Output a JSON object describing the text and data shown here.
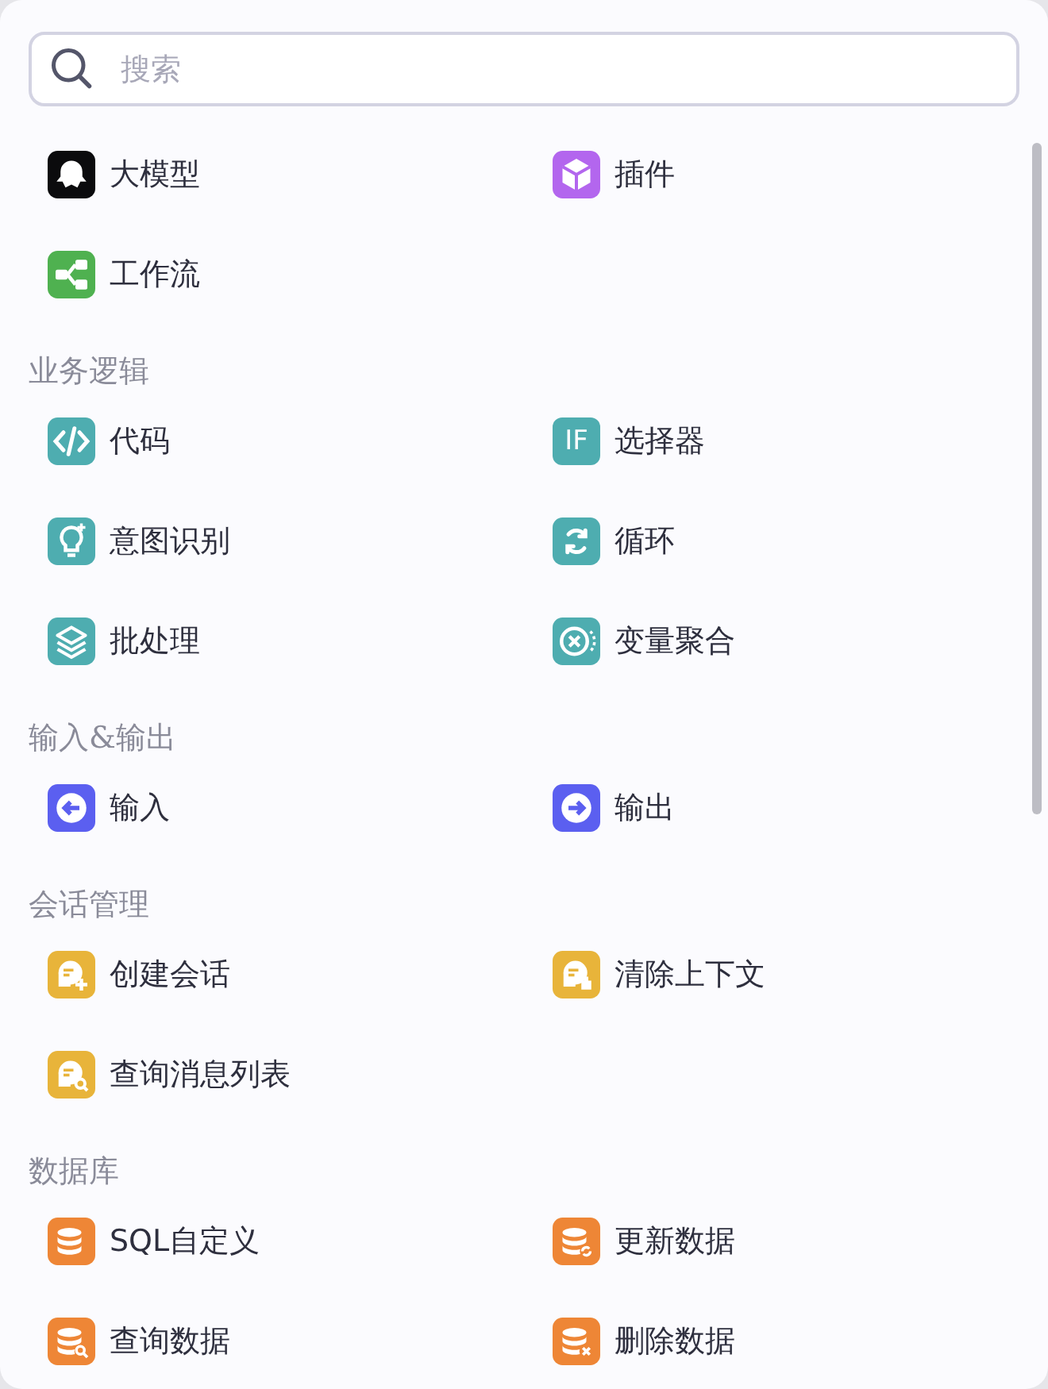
{
  "search": {
    "placeholder": "搜索"
  },
  "sections": [
    {
      "items": [
        {
          "label": "大模型",
          "kind": "ghost"
        },
        {
          "label": "插件",
          "kind": "cube"
        },
        {
          "label": "工作流",
          "kind": "flow"
        }
      ]
    },
    {
      "title": "业务逻辑",
      "items": [
        {
          "label": "代码",
          "kind": "code"
        },
        {
          "label": "选择器",
          "kind": "text",
          "glyph": "IF"
        },
        {
          "label": "意图识别",
          "kind": "bulb"
        },
        {
          "label": "循环",
          "kind": "loop"
        },
        {
          "label": "批处理",
          "kind": "layers"
        },
        {
          "label": "变量聚合",
          "kind": "variable"
        }
      ]
    },
    {
      "title": "输入&输出",
      "items": [
        {
          "label": "输入",
          "kind": "input"
        },
        {
          "label": "输出",
          "kind": "output"
        }
      ]
    },
    {
      "title": "会话管理",
      "items": [
        {
          "label": "创建会话",
          "kind": "chat-add"
        },
        {
          "label": "清除上下文",
          "kind": "chat-clear"
        },
        {
          "label": "查询消息列表",
          "kind": "chat-search"
        }
      ]
    },
    {
      "title": "数据库",
      "items": [
        {
          "label": "SQL自定义",
          "kind": "db"
        },
        {
          "label": "更新数据",
          "kind": "db-refresh"
        },
        {
          "label": "查询数据",
          "kind": "db-search"
        },
        {
          "label": "删除数据",
          "kind": "db-delete"
        }
      ]
    }
  ]
}
